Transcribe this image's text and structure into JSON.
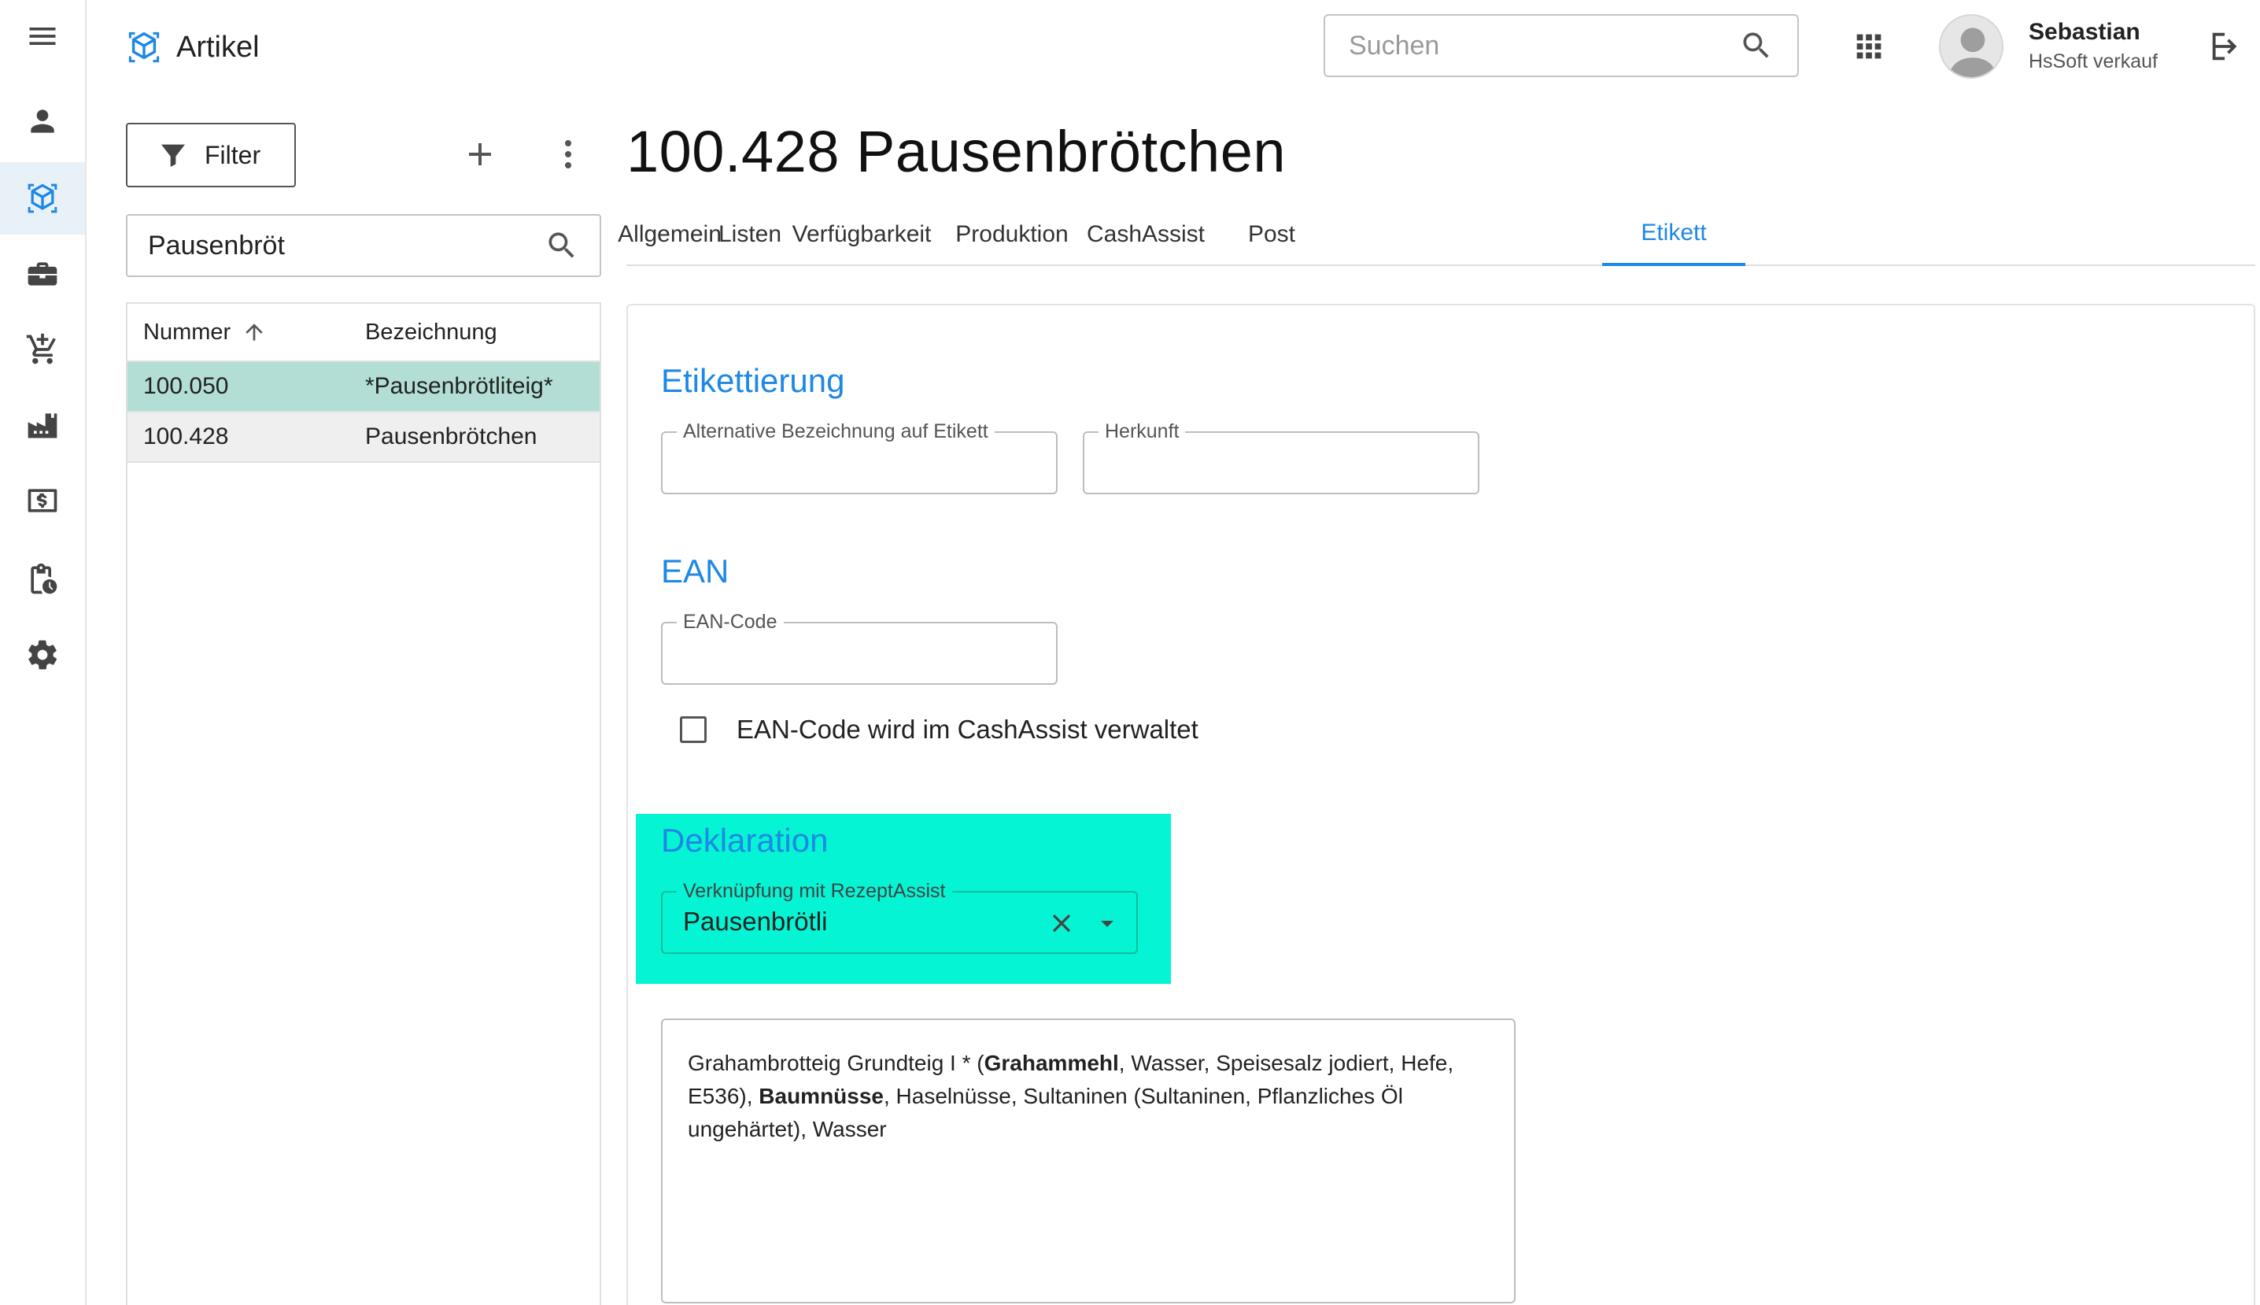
{
  "app": {
    "title": "Artikel",
    "accent_color": "#1e88e5"
  },
  "rail": {
    "items": [
      {
        "icon": "menu-icon"
      },
      {
        "icon": "person-icon"
      },
      {
        "icon": "article-cube-icon",
        "active": true
      },
      {
        "icon": "briefcase-icon"
      },
      {
        "icon": "cart-icon"
      },
      {
        "icon": "factory-icon"
      },
      {
        "icon": "cash-icon"
      },
      {
        "icon": "clipboard-clock-icon"
      },
      {
        "icon": "gear-icon"
      }
    ]
  },
  "header": {
    "search_placeholder": "Suchen",
    "user_name": "Sebastian",
    "user_role": "HsSoft verkauf"
  },
  "list_panel": {
    "filter_label": "Filter",
    "search_value": "Pausenbröt",
    "columns": [
      "Nummer",
      "Bezeichnung"
    ],
    "sort_column": "Nummer",
    "rows": [
      {
        "number": "100.050",
        "name": "*Pausenbrötliteig*",
        "selected": true
      },
      {
        "number": "100.428",
        "name": "Pausenbrötchen",
        "selected": false
      }
    ],
    "selected_row_color": "#b3ded5"
  },
  "detail": {
    "title": "100.428 Pausenbrötchen",
    "tabs": [
      {
        "label": "Allgemein"
      },
      {
        "label": "Listen"
      },
      {
        "label": "Verfügbarkeit"
      },
      {
        "label": "Produktion"
      },
      {
        "label": "CashAssist"
      },
      {
        "label": "Post"
      },
      {
        "label": "Etikett",
        "active": true
      }
    ],
    "etikettierung": {
      "heading": "Etikettierung",
      "alt_label": "Alternative Bezeichnung auf Etikett",
      "alt_value": "",
      "herkunft_label": "Herkunft",
      "herkunft_value": ""
    },
    "ean": {
      "heading": "EAN",
      "code_label": "EAN-Code",
      "code_value": "",
      "checkbox_label": "EAN-Code wird im CashAssist verwaltet",
      "checkbox_checked": false
    },
    "deklaration": {
      "heading": "Deklaration",
      "highlight_color": "#04f4d4",
      "link_label": "Verknüpfung mit RezeptAssist",
      "link_value": "Pausenbrötli",
      "text_parts": [
        {
          "t": "Grahambrotteig Grundteig I * (",
          "b": false
        },
        {
          "t": "Grahammehl",
          "b": true
        },
        {
          "t": ", Wasser, Speisesalz jodiert, Hefe, E536), ",
          "b": false
        },
        {
          "t": "Baumnüsse",
          "b": true
        },
        {
          "t": ", Haselnüsse, Sultaninen (Sultaninen, Pflanzliches Öl ungehärtet), Wasser",
          "b": false
        }
      ]
    }
  }
}
